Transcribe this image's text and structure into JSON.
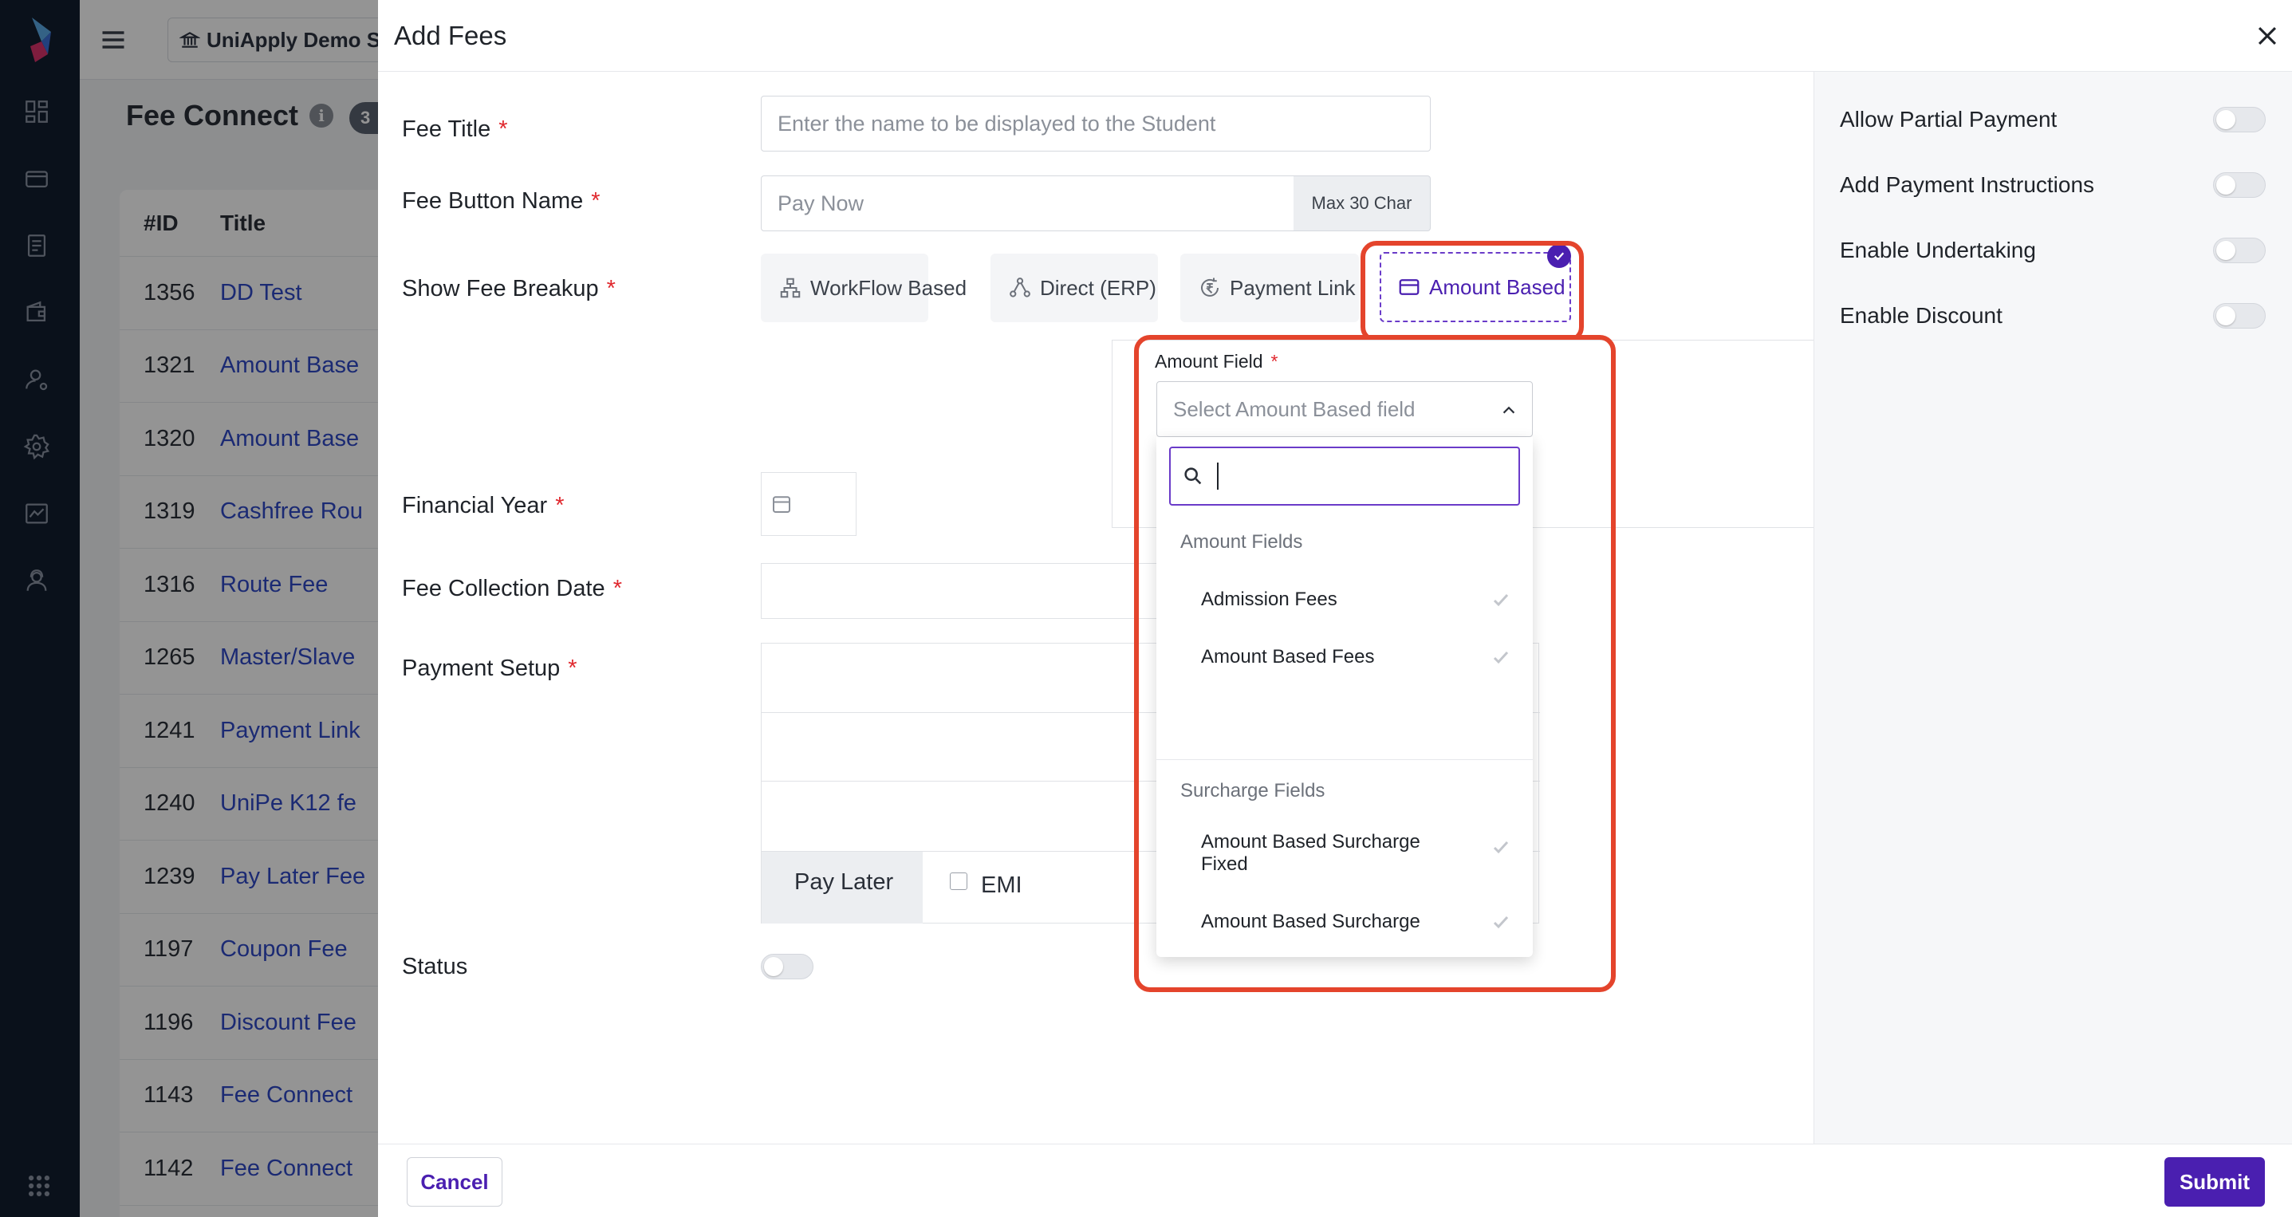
{
  "background": {
    "school_name": "UniApply Demo Sc",
    "page_title": "Fee Connect",
    "count_badge": "3",
    "table": {
      "headers": [
        "#ID",
        "Title"
      ],
      "rows": [
        {
          "id": "1356",
          "title": "DD Test"
        },
        {
          "id": "1321",
          "title": "Amount Base"
        },
        {
          "id": "1320",
          "title": "Amount Base"
        },
        {
          "id": "1319",
          "title": "Cashfree Rou"
        },
        {
          "id": "1316",
          "title": "Route Fee"
        },
        {
          "id": "1265",
          "title": "Master/Slave"
        },
        {
          "id": "1241",
          "title": "Payment Link"
        },
        {
          "id": "1240",
          "title": "UniPe K12 fe"
        },
        {
          "id": "1239",
          "title": "Pay Later Fee"
        },
        {
          "id": "1197",
          "title": "Coupon Fee"
        },
        {
          "id": "1196",
          "title": "Discount Fee"
        },
        {
          "id": "1143",
          "title": "Fee Connect"
        },
        {
          "id": "1142",
          "title": "Fee Connect"
        }
      ]
    }
  },
  "drawer": {
    "title": "Add Fees",
    "fee_title": {
      "label": "Fee Title",
      "placeholder": "Enter the name to be displayed to the Student",
      "value": ""
    },
    "fee_button_name": {
      "label": "Fee Button Name",
      "placeholder": "Pay Now",
      "addon": "Max 30 Char"
    },
    "show_fee_breakup": {
      "label": "Show Fee Breakup",
      "options": [
        {
          "label": "WorkFlow Based",
          "icon": "workflow-icon"
        },
        {
          "label": "Direct (ERP)",
          "icon": "network-icon"
        },
        {
          "label": "Payment Link",
          "icon": "rupee-refresh-icon"
        },
        {
          "label": "Amount Based",
          "icon": "card-icon"
        }
      ],
      "selected": "Amount Based"
    },
    "amount_field": {
      "label": "Amount Field",
      "placeholder": "Select Amount Based field",
      "search_value": "",
      "groups": [
        {
          "name": "Amount Fields",
          "items": [
            "Admission Fees",
            "Amount Based Fees"
          ]
        },
        {
          "name": "Surcharge Fields",
          "items": [
            "Amount Based Surcharge Fixed",
            "Amount Based Surcharge"
          ]
        }
      ]
    },
    "financial_year": {
      "label": "Financial Year"
    },
    "fee_collection_date": {
      "label": "Fee Collection Date"
    },
    "payment_setup": {
      "label": "Payment Setup",
      "visible_options": [
        "Pay Later",
        "EMI"
      ]
    },
    "status": {
      "label": "Status",
      "on": false
    },
    "settings": [
      {
        "label": "Allow Partial Payment",
        "on": false
      },
      {
        "label": "Add Payment Instructions",
        "on": false
      },
      {
        "label": "Enable Undertaking",
        "on": false
      },
      {
        "label": "Enable Discount",
        "on": false
      }
    ],
    "cancel_label": "Cancel",
    "submit_label": "Submit",
    "colors": {
      "primary": "#4a1fb0",
      "highlight": "#e4442c",
      "required": "#e0282e"
    }
  }
}
